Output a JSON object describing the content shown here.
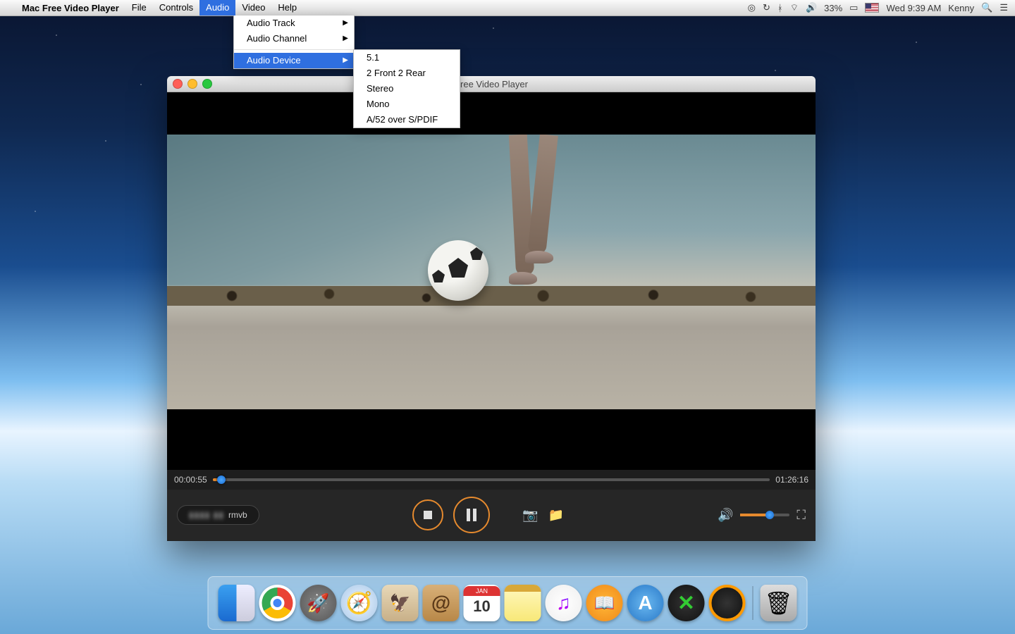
{
  "menubar": {
    "app_name": "Mac Free Video Player",
    "items": [
      "File",
      "Controls",
      "Audio",
      "Video",
      "Help"
    ],
    "selected_index": 2,
    "right": {
      "battery_pct": "33%",
      "clock": "Wed 9:39 AM",
      "user": "Kenny"
    }
  },
  "audio_menu": {
    "items": [
      {
        "label": "Audio Track",
        "submenu": true
      },
      {
        "label": "Audio Channel",
        "submenu": true
      },
      {
        "label": "Audio Device",
        "submenu": true,
        "selected": true
      }
    ]
  },
  "device_submenu": {
    "items": [
      "5.1",
      "2 Front 2 Rear",
      "Stereo",
      "Mono",
      "A/52 over S/PDIF"
    ]
  },
  "player": {
    "title": "Free Video Player",
    "time_elapsed": "00:00:55",
    "time_total": "01:26:16",
    "file_hidden": "▮▮▮▮ ▮▮",
    "file_ext": "rmvb"
  },
  "dock": {
    "cal_day": "10"
  }
}
